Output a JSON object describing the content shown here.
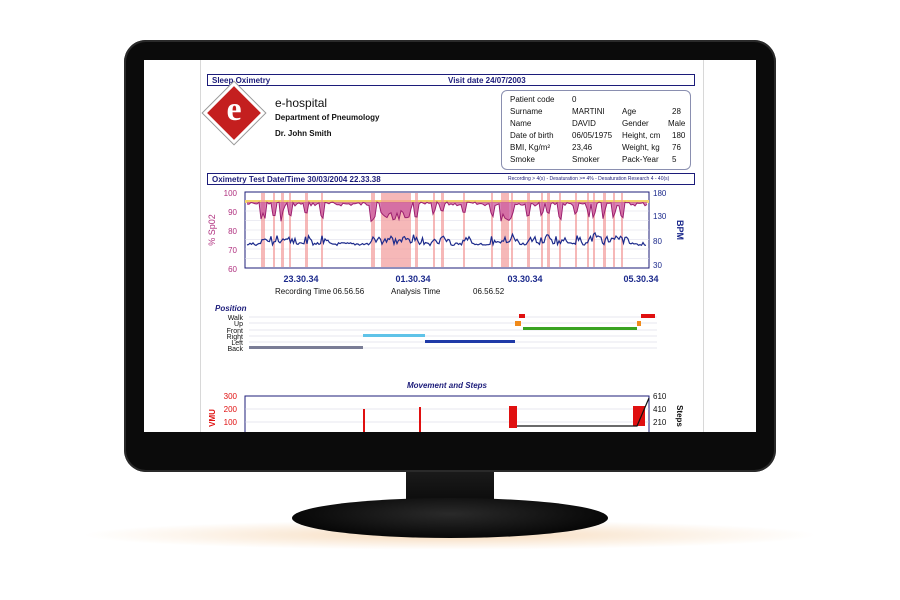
{
  "report": {
    "title": "Sleep Oximetry",
    "visit_date": "Visit date 24/07/2003",
    "hospital": "e-hospital",
    "logo_letter": "e",
    "department": "Department of Pneumology",
    "doctor": "Dr. John Smith"
  },
  "patient": {
    "code_label": "Patient code",
    "code": "0",
    "surname_label": "Surname",
    "surname": "MARTINI",
    "name_label": "Name",
    "name": "DAVID",
    "dob_label": "Date of birth",
    "dob": "06/05/1975",
    "bmi_label": "BMI, Kg/m²",
    "bmi": "23,46",
    "smoke_label": "Smoke",
    "smoke": "Smoker",
    "age_label": "Age",
    "age": "28",
    "gender_label": "Gender",
    "gender": "Male",
    "height_label": "Height, cm",
    "height": "180",
    "weight_label": "Weight, kg",
    "weight": "76",
    "packyear_label": "Pack-Year",
    "packyear": "5"
  },
  "oximetry": {
    "header": "Oximetry Test Date/Time 30/03/2004 22.33.38",
    "criteria": "Recording > 4(s) - Desaturation >= 4% - Desaturation Research 4 - 40(s)",
    "left_axis_label": "% Sp02",
    "right_axis_label": "BPM",
    "left_ticks": [
      "100",
      "90",
      "80",
      "70",
      "60"
    ],
    "right_ticks": [
      "180",
      "130",
      "80",
      "30"
    ],
    "time_ticks": [
      "23.30.34",
      "01.30.34",
      "03.30.34",
      "05.30.34"
    ],
    "recording_time_label": "Recording Time",
    "recording_time": "06.56.56",
    "analysis_time_label": "Analysis Time",
    "analysis_time": "06.56.52"
  },
  "position": {
    "title": "Position",
    "labels": [
      "Walk",
      "Up",
      "Front",
      "Right",
      "Left",
      "Back"
    ]
  },
  "movement": {
    "title": "Movement and Steps",
    "left_axis_label": "VMU",
    "right_axis_label": "Steps",
    "left_ticks": [
      "300",
      "200",
      "100"
    ],
    "right_ticks": [
      "610",
      "410",
      "210"
    ]
  },
  "colors": {
    "frame": "#1c1c7a",
    "spo2": "#b0307f",
    "bpm": "#1c2a8c",
    "desaturation": "#f29a9a",
    "movement": "#e01010"
  }
}
